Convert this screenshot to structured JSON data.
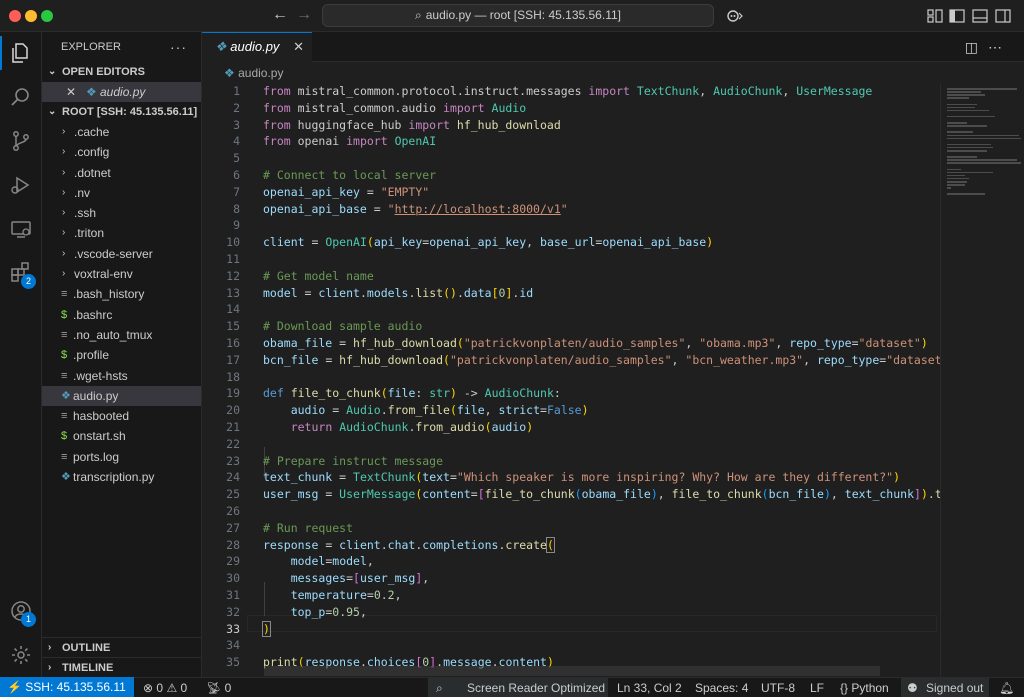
{
  "titlebar": {
    "title": "audio.py — root [SSH: 45.135.56.11]",
    "icons": [
      "back-arrow-icon",
      "forward-arrow-icon",
      "copilot-icon",
      "layout-icon"
    ]
  },
  "activity": {
    "accounts_badge": "1",
    "extensions_badge": "2"
  },
  "explorer": {
    "title": "EXPLORER",
    "open_editors_label": "OPEN EDITORS",
    "open_editor_file": "audio.py",
    "root_label": "ROOT [SSH: 45.135.56.11]",
    "folders": [
      ".cache",
      ".config",
      ".dotnet",
      ".nv",
      ".ssh",
      ".triton",
      ".vscode-server",
      "voxtral-env"
    ],
    "files": [
      {
        "name": ".bash_history",
        "icon": "lines-icon"
      },
      {
        "name": ".bashrc",
        "icon": "dollar-icon"
      },
      {
        "name": ".no_auto_tmux",
        "icon": "lines-icon"
      },
      {
        "name": ".profile",
        "icon": "dollar-icon"
      },
      {
        "name": ".wget-hsts",
        "icon": "lines-icon"
      },
      {
        "name": "audio.py",
        "icon": "python-icon"
      },
      {
        "name": "hasbooted",
        "icon": "lines-icon"
      },
      {
        "name": "onstart.sh",
        "icon": "dollar-icon"
      },
      {
        "name": "ports.log",
        "icon": "lines-icon"
      },
      {
        "name": "transcription.py",
        "icon": "python-icon"
      }
    ],
    "outline_label": "OUTLINE",
    "timeline_label": "TIMELINE"
  },
  "editor": {
    "tab_label": "audio.py",
    "breadcrumb": "audio.py",
    "line_numbers": [
      "1",
      "2",
      "3",
      "4",
      "5",
      "6",
      "7",
      "8",
      "9",
      "10",
      "11",
      "12",
      "13",
      "14",
      "15",
      "16",
      "17",
      "18",
      "19",
      "20",
      "21",
      "22",
      "23",
      "24",
      "25",
      "26",
      "27",
      "28",
      "29",
      "30",
      "31",
      "32",
      "33",
      "34",
      "35"
    ],
    "current_line": "33"
  },
  "status": {
    "remote": "SSH: 45.135.56.11",
    "errors": "0",
    "warnings": "0",
    "ports": "0",
    "screen_reader": "Screen Reader Optimized",
    "position": "Ln 33, Col 2",
    "spaces": "Spaces: 4",
    "encoding": "UTF-8",
    "eol": "LF",
    "language": "Python",
    "signed_out": "Signed out"
  }
}
